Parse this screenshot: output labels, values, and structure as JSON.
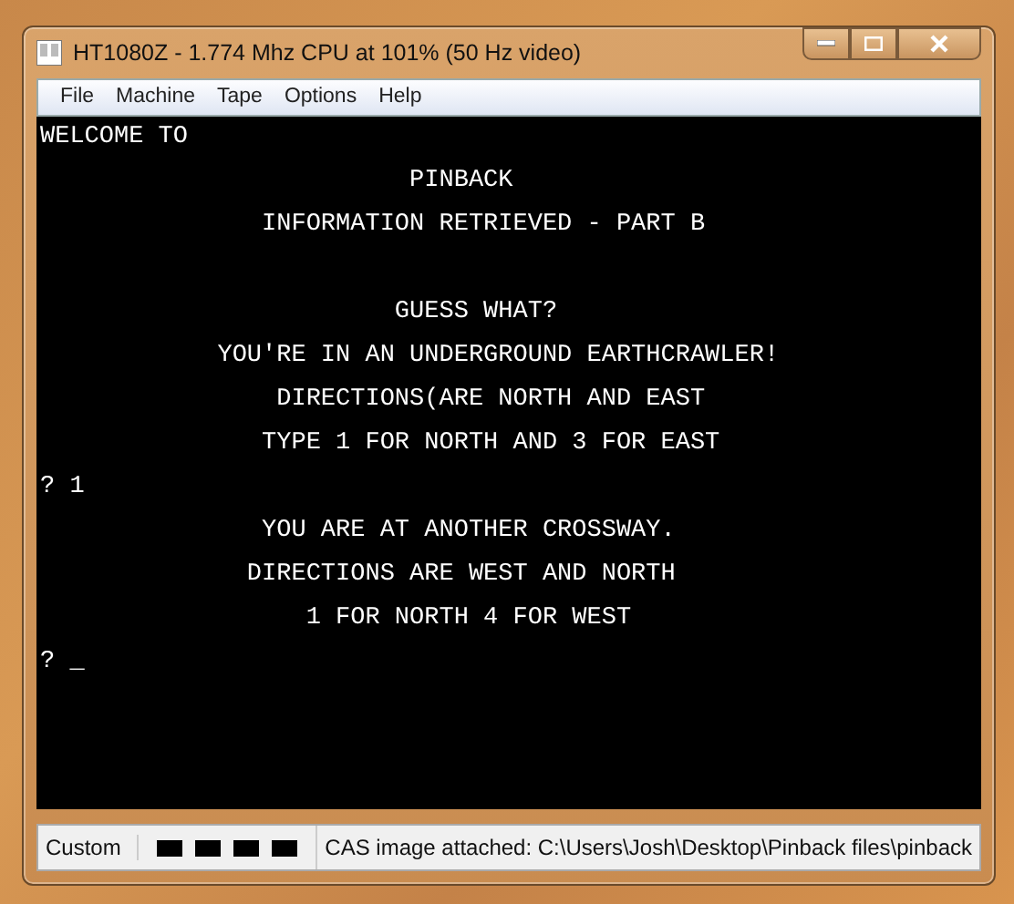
{
  "window": {
    "title": "HT1080Z - 1.774 Mhz CPU at 101% (50 Hz video)"
  },
  "menu": [
    "File",
    "Machine",
    "Tape",
    "Options",
    "Help"
  ],
  "screen": {
    "blocks": [
      [
        "WELCOME TO",
        "                         PINBACK",
        "               INFORMATION RETRIEVED - PART B"
      ],
      [
        "                        GUESS WHAT?",
        "            YOU'RE IN AN UNDERGROUND EARTHCRAWLER!",
        "                DIRECTIONS(ARE NORTH AND EAST",
        "               TYPE 1 FOR NORTH AND 3 FOR EAST",
        "? 1",
        "               YOU ARE AT ANOTHER CROSSWAY.",
        "              DIRECTIONS ARE WEST AND NORTH",
        "                  1 FOR NORTH 4 FOR WEST",
        "? _"
      ]
    ]
  },
  "status_bar": {
    "mode": "Custom",
    "message": "CAS image attached: C:\\Users\\Josh\\Desktop\\Pinback files\\pinback"
  }
}
